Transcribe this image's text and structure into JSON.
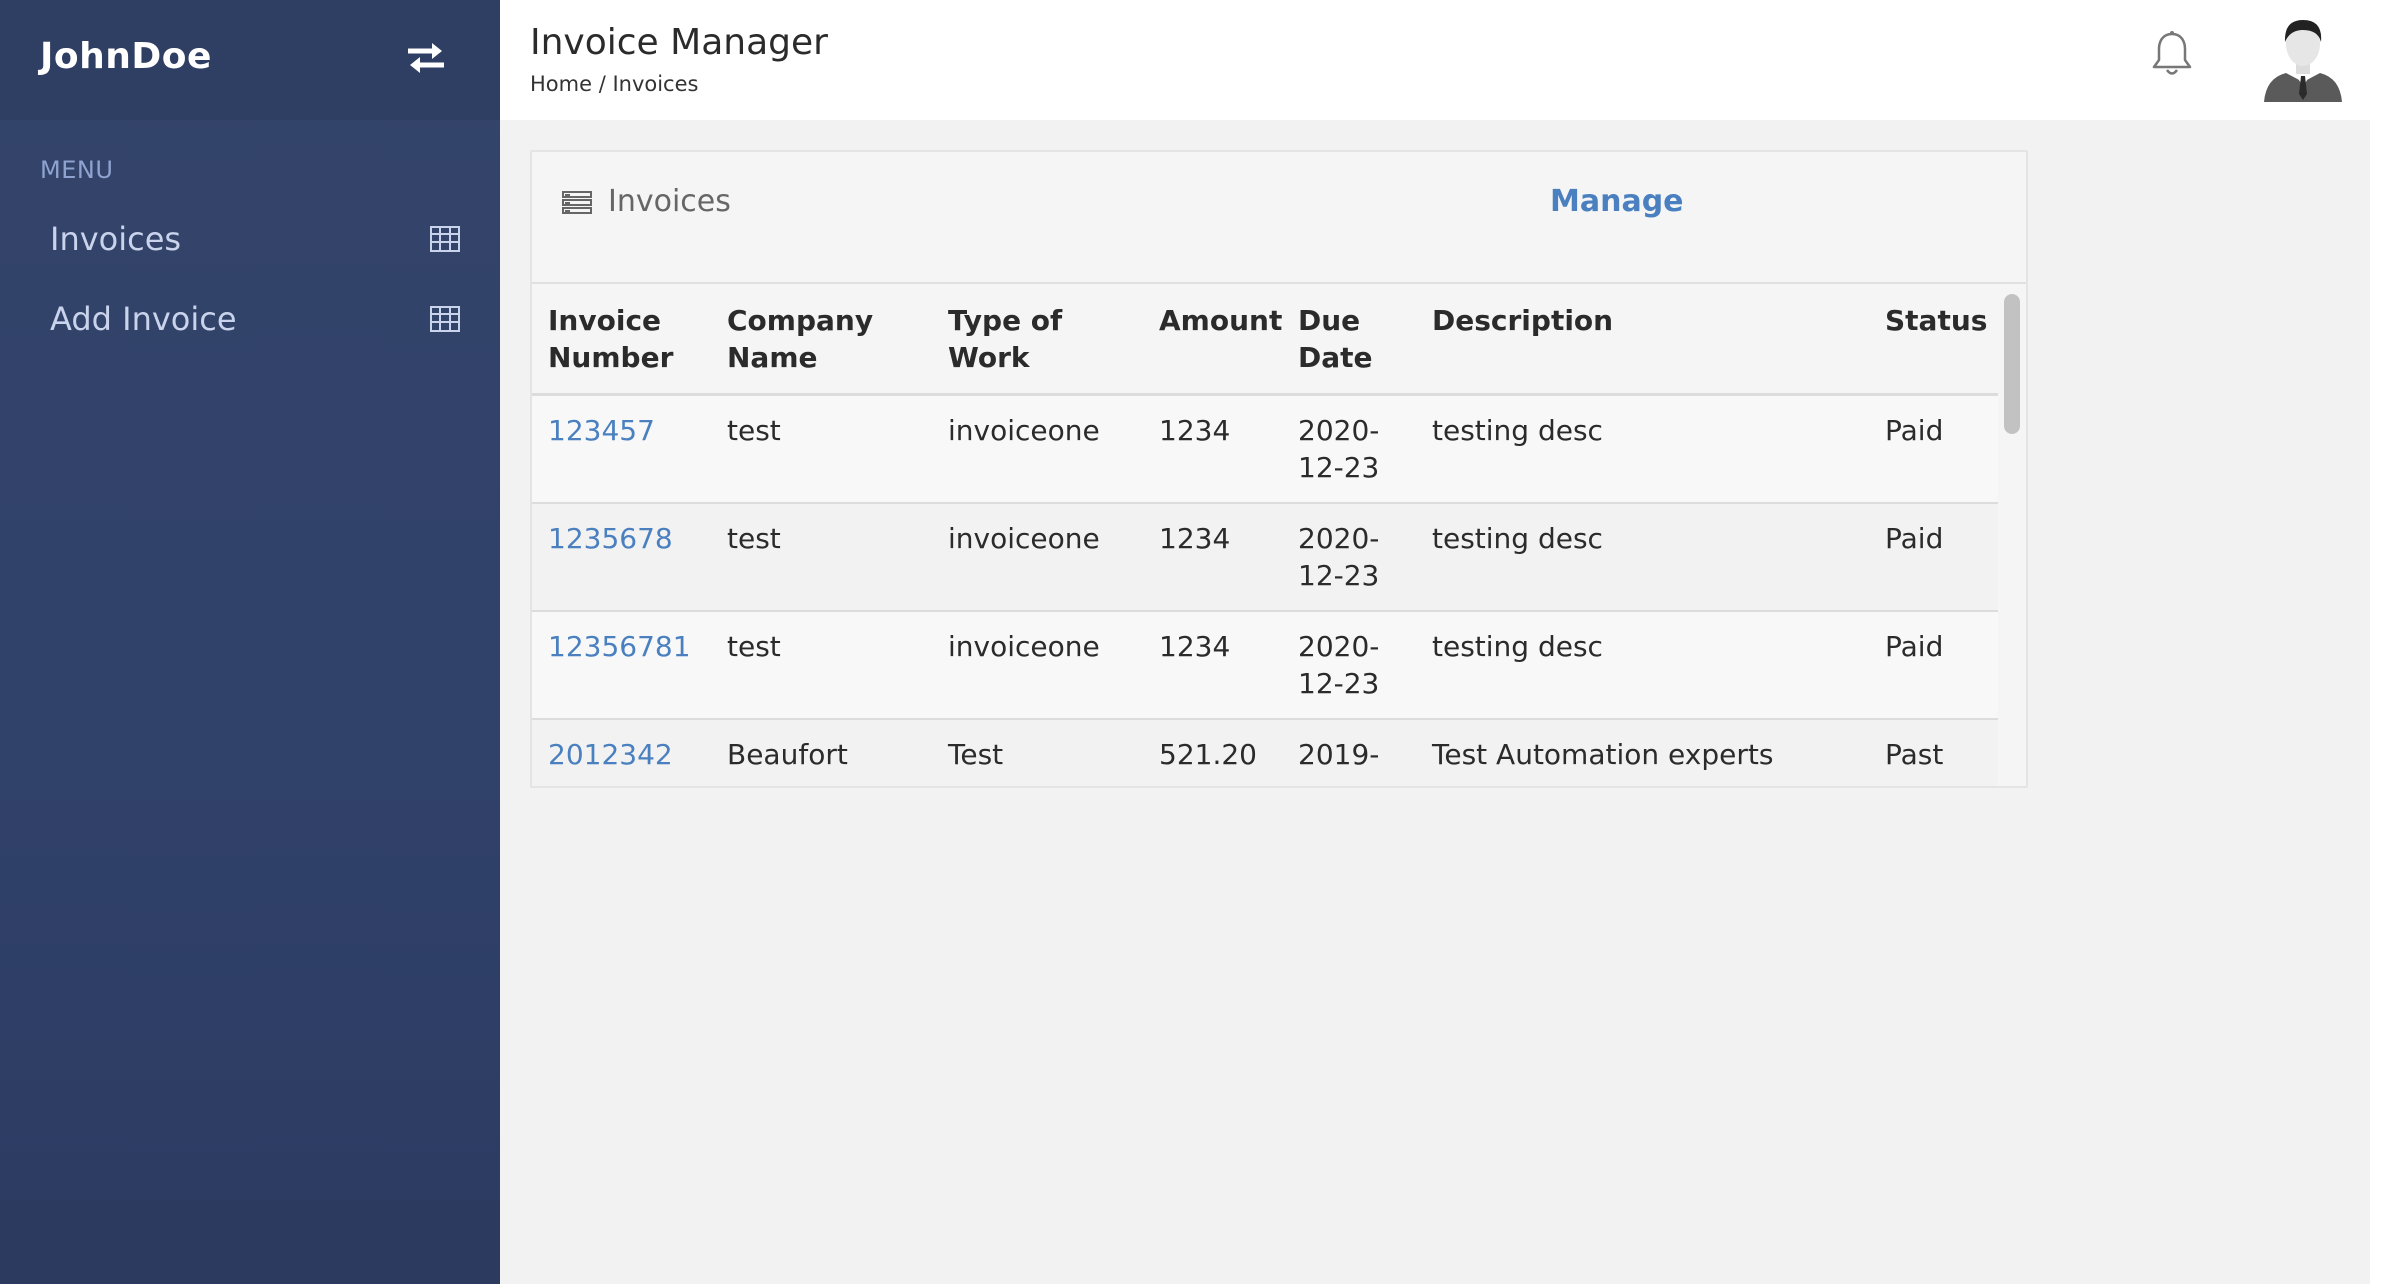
{
  "sidebar": {
    "brand": "JohnDoe",
    "menu_header": "MENU",
    "items": [
      {
        "label": "Invoices",
        "icon": "table-grid-icon"
      },
      {
        "label": "Add Invoice",
        "icon": "table-grid-icon"
      }
    ]
  },
  "header": {
    "title": "Invoice Manager",
    "breadcrumb": "Home / Invoices"
  },
  "card": {
    "title": "Invoices",
    "manage_link": "Manage"
  },
  "table": {
    "columns": [
      "Invoice Number",
      "Company Name",
      "Type of Work",
      "Amount",
      "Due Date",
      "Description",
      "Status"
    ],
    "rows": [
      {
        "invoice_number": "123457",
        "company": "test",
        "type": "invoiceone",
        "amount": "1234",
        "due_date": "2020-12-23",
        "description": "testing desc",
        "status": "Paid"
      },
      {
        "invoice_number": "1235678",
        "company": "test",
        "type": "invoiceone",
        "amount": "1234",
        "due_date": "2020-12-23",
        "description": "testing desc",
        "status": "Paid"
      },
      {
        "invoice_number": "12356781",
        "company": "test",
        "type": "invoiceone",
        "amount": "1234",
        "due_date": "2020-12-23",
        "description": "testing desc",
        "status": "Paid"
      },
      {
        "invoice_number": "2012342",
        "company": "Beaufort",
        "type": "Test",
        "amount": "521.20",
        "due_date": "2019-",
        "description": "Test Automation experts",
        "status": "Past"
      }
    ]
  },
  "colors": {
    "sidebar_bg": "#30416a",
    "link_blue": "#4a80c0",
    "page_bg": "#f2f2f2"
  }
}
